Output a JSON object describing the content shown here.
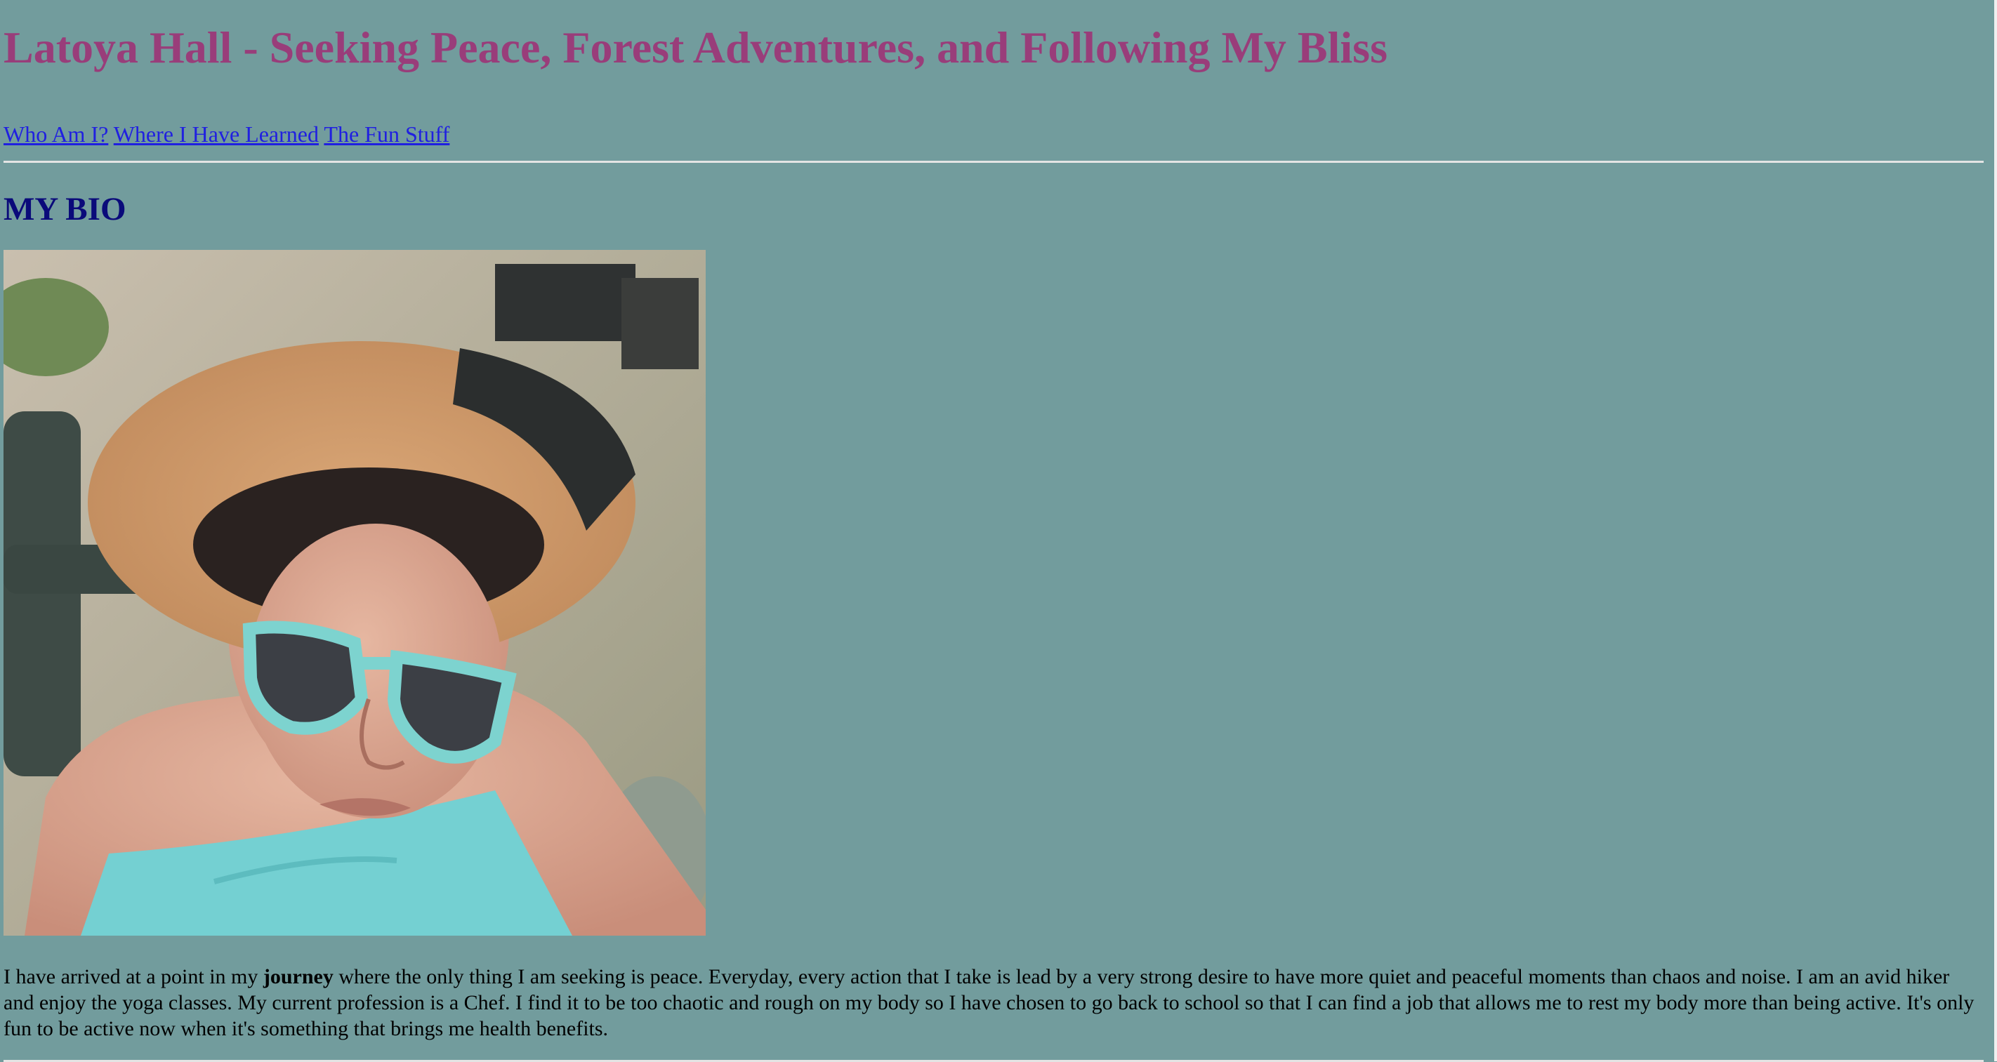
{
  "header": {
    "title": "Latoya Hall - Seeking Peace, Forest Adventures, and Following My Bliss"
  },
  "nav": {
    "links": [
      "Who Am I?",
      "Where I Have Learned",
      "The Fun Stuff"
    ]
  },
  "bio": {
    "heading": "MY BIO",
    "text_before": "I have arrived at a point in my ",
    "text_bold": "journey",
    "text_after": " where the only thing I am seeking is peace. Everyday, every action that I take is lead by a very strong desire to have more quiet and peaceful moments than chaos and noise. I am an avid hiker and enjoy the yoga classes. My current profession is a Chef. I find it to be too chaotic and rough on my body so I have chosen to go back to school so that I can find a job that allows me to rest my body more than being active. It's only fun to be active now when it's something that brings me health benefits."
  },
  "colors": {
    "page_background": "#729c9d",
    "title": "#993d7a",
    "heading": "#0a0a7a",
    "link": "#2020e0"
  }
}
